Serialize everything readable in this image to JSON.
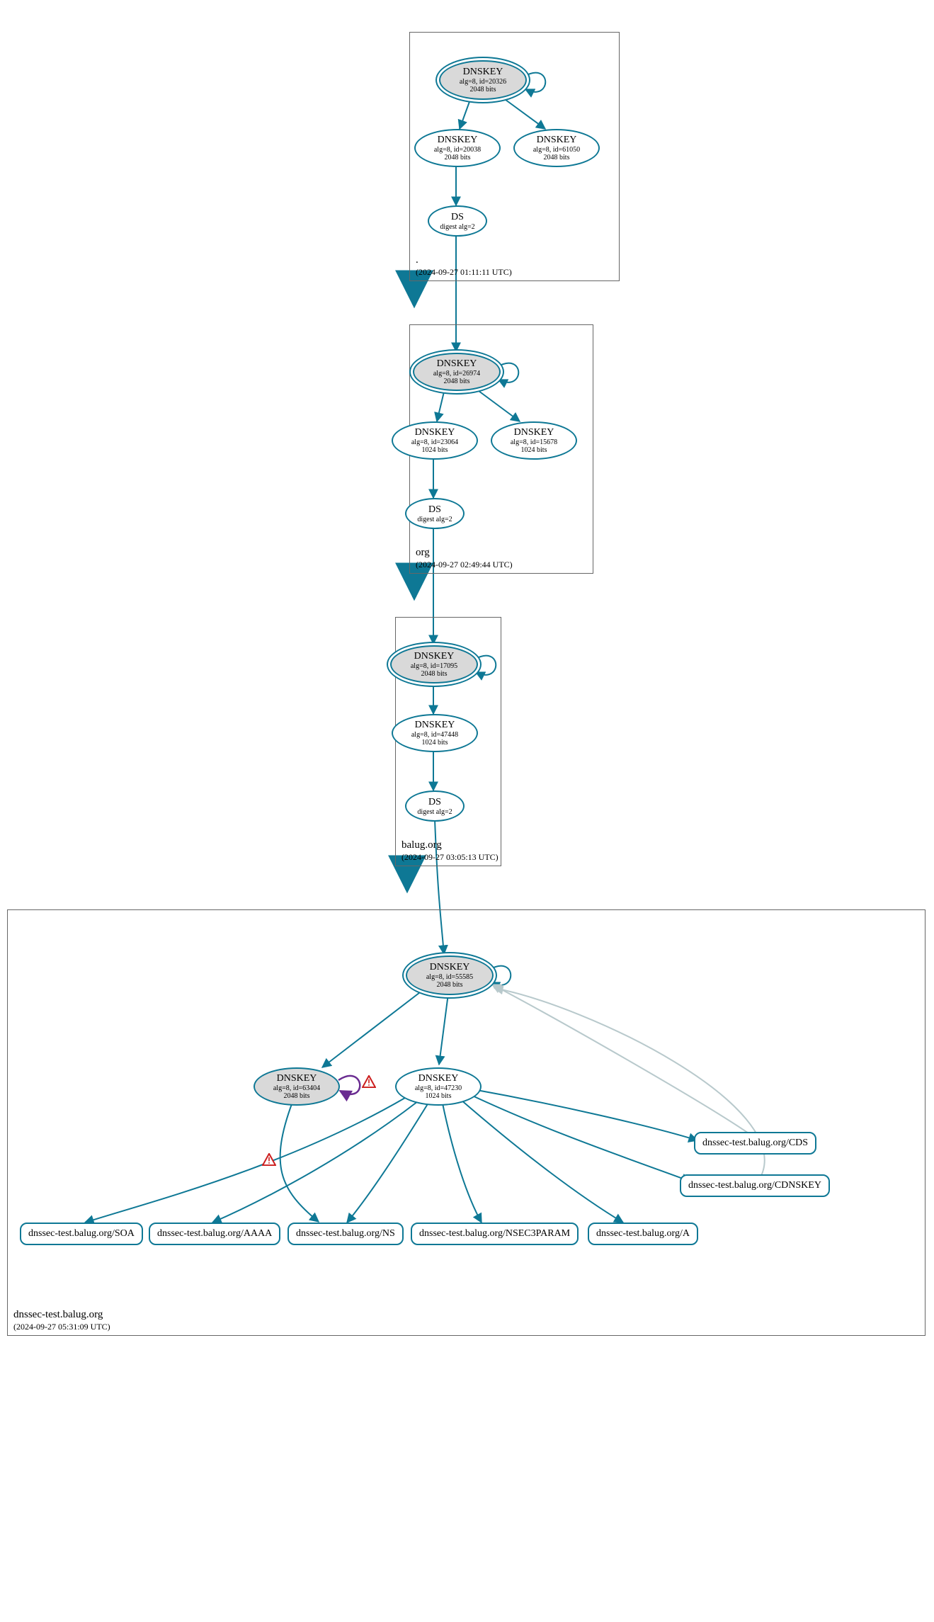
{
  "zones": {
    "root": {
      "title": ".",
      "ts": "(2024-09-27 01:11:11 UTC)"
    },
    "org": {
      "title": "org",
      "ts": "(2024-09-27 02:49:44 UTC)"
    },
    "balug": {
      "title": "balug.org",
      "ts": "(2024-09-27 03:05:13 UTC)"
    },
    "dnssectest": {
      "title": "dnssec-test.balug.org",
      "ts": "(2024-09-27 05:31:09 UTC)"
    }
  },
  "labels": {
    "dnskey": "DNSKEY",
    "ds": "DS",
    "digest2": "digest alg=2"
  },
  "keys": {
    "root_ksk": {
      "sub": "alg=8, id=20326",
      "bits": "2048 bits"
    },
    "root_zsk1": {
      "sub": "alg=8, id=20038",
      "bits": "2048 bits"
    },
    "root_zsk2": {
      "sub": "alg=8, id=61050",
      "bits": "2048 bits"
    },
    "org_ksk": {
      "sub": "alg=8, id=26974",
      "bits": "2048 bits"
    },
    "org_zsk1": {
      "sub": "alg=8, id=23064",
      "bits": "1024 bits"
    },
    "org_zsk2": {
      "sub": "alg=8, id=15678",
      "bits": "1024 bits"
    },
    "balug_ksk": {
      "sub": "alg=8, id=17095",
      "bits": "2048 bits"
    },
    "balug_zsk": {
      "sub": "alg=8, id=47448",
      "bits": "1024 bits"
    },
    "dt_ksk": {
      "sub": "alg=8, id=55585",
      "bits": "2048 bits"
    },
    "dt_k1": {
      "sub": "alg=8, id=63404",
      "bits": "2048 bits"
    },
    "dt_k2": {
      "sub": "alg=8, id=47230",
      "bits": "1024 bits"
    }
  },
  "rrsets": {
    "soa": "dnssec-test.balug.org/SOA",
    "aaaa": "dnssec-test.balug.org/AAAA",
    "ns": "dnssec-test.balug.org/NS",
    "nsec3param": "dnssec-test.balug.org/NSEC3PARAM",
    "a": "dnssec-test.balug.org/A",
    "cds": "dnssec-test.balug.org/CDS",
    "cdnskey": "dnssec-test.balug.org/CDNSKEY"
  },
  "colors": {
    "edge": "#0e7895",
    "edge_light": "#b8c9cc",
    "edge_purple": "#6a2c91",
    "warn_red": "#cc1f1f"
  }
}
